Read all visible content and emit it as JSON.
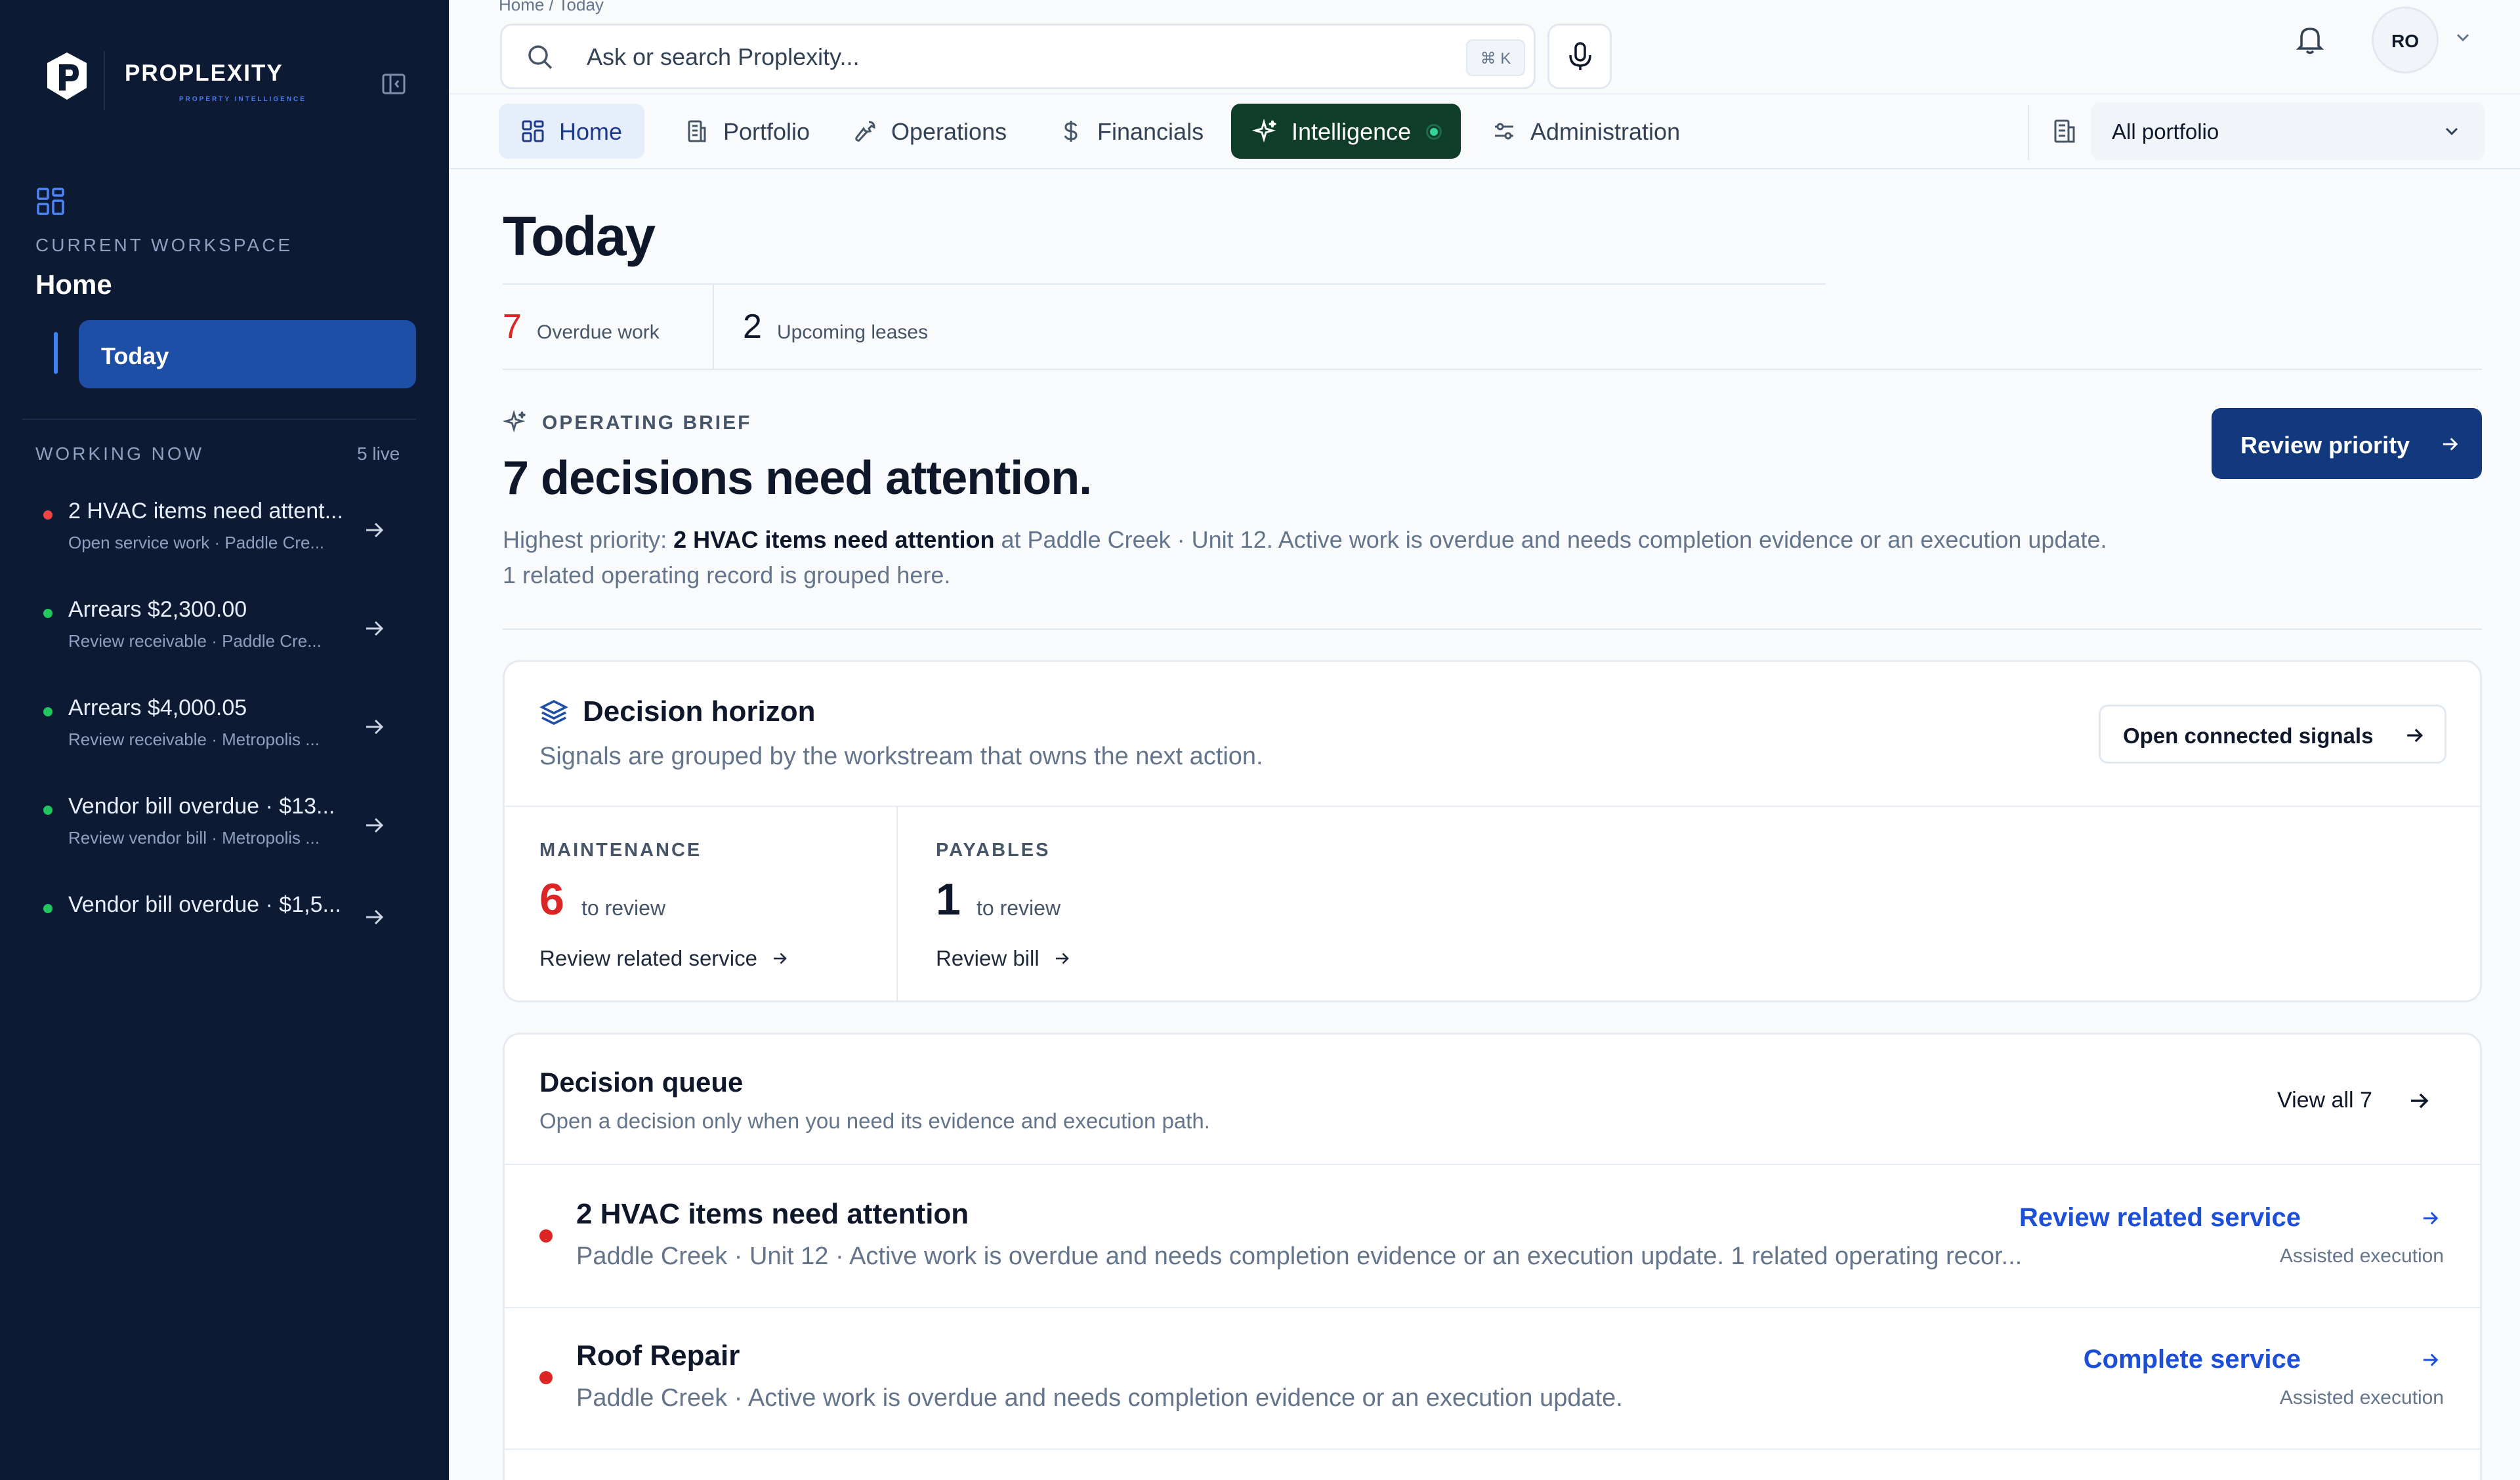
{
  "brand": {
    "name": "PROPLEXITY",
    "tagline": "PROPERTY INTELLIGENCE"
  },
  "sidebar": {
    "workspace_label": "CURRENT WORKSPACE",
    "workspace_name": "Home",
    "active_item": "Today",
    "working_label": "WORKING NOW",
    "working_count": "5 live",
    "items": [
      {
        "title": "2 HVAC items need attent...",
        "sub": "Open service work · Paddle Cre...",
        "status": "red"
      },
      {
        "title": "Arrears $2,300.00",
        "sub": "Review receivable · Paddle Cre...",
        "status": "green"
      },
      {
        "title": "Arrears $4,000.05",
        "sub": "Review receivable · Metropolis ...",
        "status": "green"
      },
      {
        "title": "Vendor bill overdue · $13...",
        "sub": "Review vendor bill · Metropolis ...",
        "status": "green"
      },
      {
        "title": "Vendor bill overdue · $1,5...",
        "sub": "",
        "status": "green"
      }
    ]
  },
  "header": {
    "breadcrumb": "Home  /  Today",
    "search_placeholder": "Ask or search Proplexity...",
    "shortcut": "⌘ K",
    "avatar_initials": "RO"
  },
  "nav": {
    "tabs": [
      "Home",
      "Portfolio",
      "Operations",
      "Financials",
      "Intelligence",
      "Administration"
    ],
    "portfolio_select": "All portfolio"
  },
  "page": {
    "title": "Today",
    "stats": [
      {
        "value": "7",
        "label": "Overdue work"
      },
      {
        "value": "2",
        "label": "Upcoming leases"
      }
    ]
  },
  "brief": {
    "label": "OPERATING BRIEF",
    "title": "7 decisions need attention.",
    "body_prefix": "Highest priority: ",
    "body_bold": "2 HVAC items need attention",
    "body_suffix": " at Paddle Creek · Unit 12. Active work is overdue and needs completion evidence or an execution update. 1 related operating record is grouped here.",
    "button": "Review priority"
  },
  "horizon": {
    "title": "Decision horizon",
    "subtitle": "Signals are grouped by the workstream that owns the next action.",
    "button": "Open connected signals",
    "columns": [
      {
        "label": "MAINTENANCE",
        "count": "6",
        "count_label": "to review",
        "link": "Review related service"
      },
      {
        "label": "PAYABLES",
        "count": "1",
        "count_label": "to review",
        "link": "Review bill"
      }
    ]
  },
  "queue": {
    "title": "Decision queue",
    "subtitle": "Open a decision only when you need its evidence and execution path.",
    "view_all": "View all 7",
    "items": [
      {
        "title": "2 HVAC items need attention",
        "sub": "Paddle Creek · Unit 12 · Active work is overdue and needs completion evidence or an execution update. 1 related operating recor...",
        "action": "Review related service",
        "meta": "Assisted execution"
      },
      {
        "title": "Roof Repair",
        "sub": "Paddle Creek · Active work is overdue and needs completion evidence or an execution update.",
        "action": "Complete service",
        "meta": "Assisted execution"
      }
    ]
  },
  "colors": {
    "sidebar_bg": "#0c1a33",
    "primary": "#12397e",
    "danger": "#dc2626",
    "success": "#22c55e",
    "intel_bg": "#0f3d2a"
  }
}
